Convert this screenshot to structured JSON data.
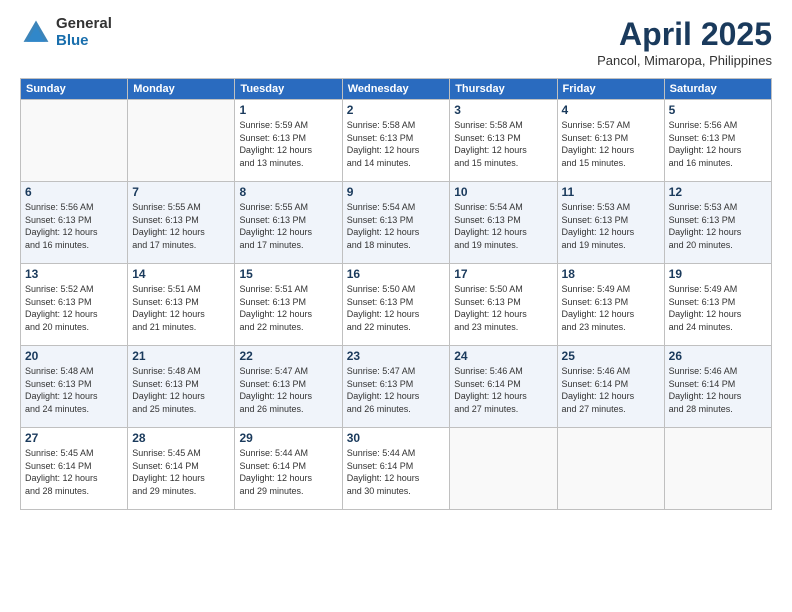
{
  "logo": {
    "general": "General",
    "blue": "Blue"
  },
  "header": {
    "title": "April 2025",
    "location": "Pancol, Mimaropa, Philippines"
  },
  "weekdays": [
    "Sunday",
    "Monday",
    "Tuesday",
    "Wednesday",
    "Thursday",
    "Friday",
    "Saturday"
  ],
  "weeks": [
    [
      {
        "day": "",
        "info": ""
      },
      {
        "day": "",
        "info": ""
      },
      {
        "day": "1",
        "info": "Sunrise: 5:59 AM\nSunset: 6:13 PM\nDaylight: 12 hours\nand 13 minutes."
      },
      {
        "day": "2",
        "info": "Sunrise: 5:58 AM\nSunset: 6:13 PM\nDaylight: 12 hours\nand 14 minutes."
      },
      {
        "day": "3",
        "info": "Sunrise: 5:58 AM\nSunset: 6:13 PM\nDaylight: 12 hours\nand 15 minutes."
      },
      {
        "day": "4",
        "info": "Sunrise: 5:57 AM\nSunset: 6:13 PM\nDaylight: 12 hours\nand 15 minutes."
      },
      {
        "day": "5",
        "info": "Sunrise: 5:56 AM\nSunset: 6:13 PM\nDaylight: 12 hours\nand 16 minutes."
      }
    ],
    [
      {
        "day": "6",
        "info": "Sunrise: 5:56 AM\nSunset: 6:13 PM\nDaylight: 12 hours\nand 16 minutes."
      },
      {
        "day": "7",
        "info": "Sunrise: 5:55 AM\nSunset: 6:13 PM\nDaylight: 12 hours\nand 17 minutes."
      },
      {
        "day": "8",
        "info": "Sunrise: 5:55 AM\nSunset: 6:13 PM\nDaylight: 12 hours\nand 17 minutes."
      },
      {
        "day": "9",
        "info": "Sunrise: 5:54 AM\nSunset: 6:13 PM\nDaylight: 12 hours\nand 18 minutes."
      },
      {
        "day": "10",
        "info": "Sunrise: 5:54 AM\nSunset: 6:13 PM\nDaylight: 12 hours\nand 19 minutes."
      },
      {
        "day": "11",
        "info": "Sunrise: 5:53 AM\nSunset: 6:13 PM\nDaylight: 12 hours\nand 19 minutes."
      },
      {
        "day": "12",
        "info": "Sunrise: 5:53 AM\nSunset: 6:13 PM\nDaylight: 12 hours\nand 20 minutes."
      }
    ],
    [
      {
        "day": "13",
        "info": "Sunrise: 5:52 AM\nSunset: 6:13 PM\nDaylight: 12 hours\nand 20 minutes."
      },
      {
        "day": "14",
        "info": "Sunrise: 5:51 AM\nSunset: 6:13 PM\nDaylight: 12 hours\nand 21 minutes."
      },
      {
        "day": "15",
        "info": "Sunrise: 5:51 AM\nSunset: 6:13 PM\nDaylight: 12 hours\nand 22 minutes."
      },
      {
        "day": "16",
        "info": "Sunrise: 5:50 AM\nSunset: 6:13 PM\nDaylight: 12 hours\nand 22 minutes."
      },
      {
        "day": "17",
        "info": "Sunrise: 5:50 AM\nSunset: 6:13 PM\nDaylight: 12 hours\nand 23 minutes."
      },
      {
        "day": "18",
        "info": "Sunrise: 5:49 AM\nSunset: 6:13 PM\nDaylight: 12 hours\nand 23 minutes."
      },
      {
        "day": "19",
        "info": "Sunrise: 5:49 AM\nSunset: 6:13 PM\nDaylight: 12 hours\nand 24 minutes."
      }
    ],
    [
      {
        "day": "20",
        "info": "Sunrise: 5:48 AM\nSunset: 6:13 PM\nDaylight: 12 hours\nand 24 minutes."
      },
      {
        "day": "21",
        "info": "Sunrise: 5:48 AM\nSunset: 6:13 PM\nDaylight: 12 hours\nand 25 minutes."
      },
      {
        "day": "22",
        "info": "Sunrise: 5:47 AM\nSunset: 6:13 PM\nDaylight: 12 hours\nand 26 minutes."
      },
      {
        "day": "23",
        "info": "Sunrise: 5:47 AM\nSunset: 6:13 PM\nDaylight: 12 hours\nand 26 minutes."
      },
      {
        "day": "24",
        "info": "Sunrise: 5:46 AM\nSunset: 6:14 PM\nDaylight: 12 hours\nand 27 minutes."
      },
      {
        "day": "25",
        "info": "Sunrise: 5:46 AM\nSunset: 6:14 PM\nDaylight: 12 hours\nand 27 minutes."
      },
      {
        "day": "26",
        "info": "Sunrise: 5:46 AM\nSunset: 6:14 PM\nDaylight: 12 hours\nand 28 minutes."
      }
    ],
    [
      {
        "day": "27",
        "info": "Sunrise: 5:45 AM\nSunset: 6:14 PM\nDaylight: 12 hours\nand 28 minutes."
      },
      {
        "day": "28",
        "info": "Sunrise: 5:45 AM\nSunset: 6:14 PM\nDaylight: 12 hours\nand 29 minutes."
      },
      {
        "day": "29",
        "info": "Sunrise: 5:44 AM\nSunset: 6:14 PM\nDaylight: 12 hours\nand 29 minutes."
      },
      {
        "day": "30",
        "info": "Sunrise: 5:44 AM\nSunset: 6:14 PM\nDaylight: 12 hours\nand 30 minutes."
      },
      {
        "day": "",
        "info": ""
      },
      {
        "day": "",
        "info": ""
      },
      {
        "day": "",
        "info": ""
      }
    ]
  ]
}
